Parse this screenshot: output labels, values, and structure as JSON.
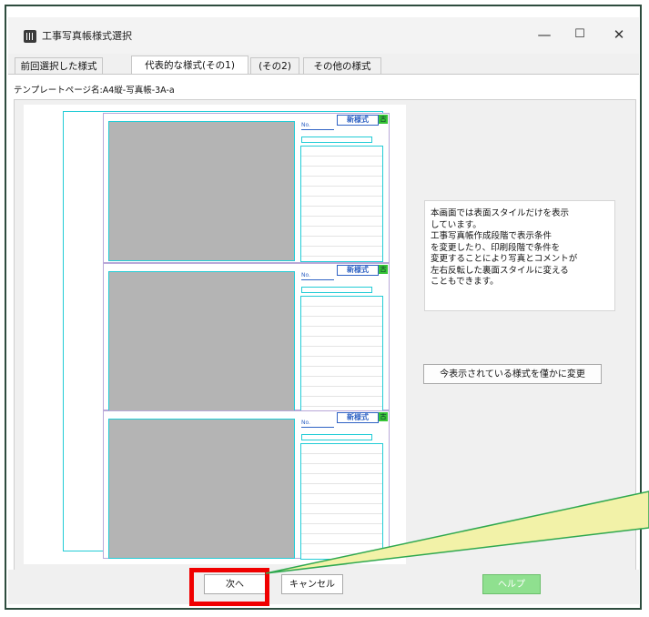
{
  "window": {
    "title": "工事写真帳様式選択",
    "controls": {
      "minimize": "—",
      "maximize": "☐",
      "close": "✕"
    }
  },
  "tabs": [
    {
      "label": "前回選択した様式",
      "active": false
    },
    {
      "label": "代表的な様式(その1)",
      "active": true
    },
    {
      "label": "(その2)",
      "active": false
    },
    {
      "label": "その他の様式",
      "active": false
    }
  ],
  "template": {
    "label": "テンプレートページ名:A4縦-写真帳-3A-a"
  },
  "preview": {
    "blocks": [
      {
        "no_label": "No.",
        "badge": "新様式",
        "tag": "古"
      },
      {
        "no_label": "No.",
        "badge": "新様式",
        "tag": "古"
      },
      {
        "no_label": "No.",
        "badge": "新様式",
        "tag": "古"
      }
    ]
  },
  "info_text": [
    "本画面では表面スタイルだけを表示",
    "しています。",
    "工事写真帳作成段階で表示条件",
    "を変更したり、印刷段階で条件を",
    "変更することにより写真とコメントが",
    "左右反転した裏面スタイルに変える",
    "こともできます。"
  ],
  "buttons": {
    "change_style": "今表示されている様式を僅かに変更",
    "next": "次へ",
    "cancel": "キャンセル",
    "help": "ヘルプ"
  },
  "colors": {
    "highlight": "#f00000",
    "help_button": "#8fe08f",
    "callout": "#f2f2a8"
  }
}
